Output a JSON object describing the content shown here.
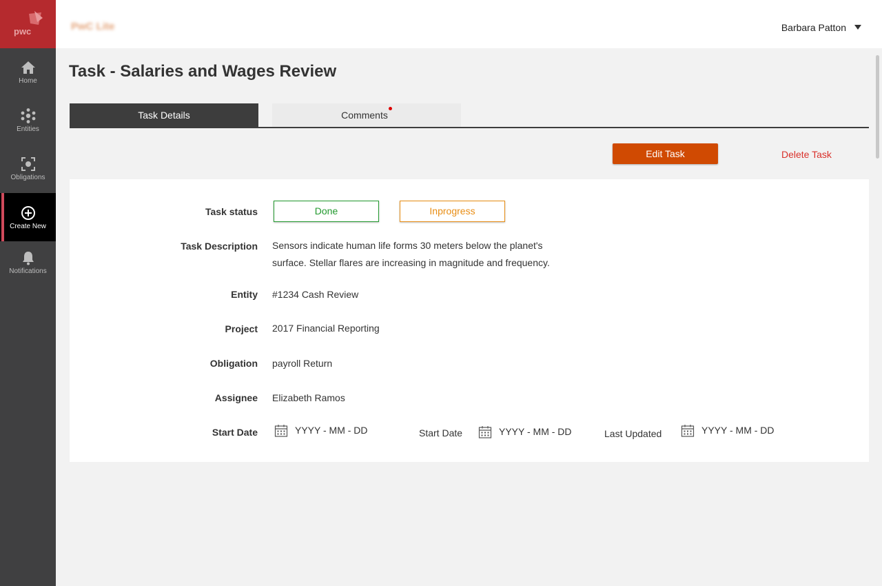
{
  "brand": {
    "name": "PwC Lite"
  },
  "user": {
    "name": "Barbara Patton"
  },
  "nav": {
    "home": "Home",
    "entities": "Entities",
    "obligations": "Obligations",
    "create_new": "Create New",
    "notifications": "Notifications"
  },
  "page": {
    "title": "Task - Salaries and Wages Review"
  },
  "tabs": {
    "details": "Task Details",
    "comments": "Comments"
  },
  "actions": {
    "edit": "Edit Task",
    "delete": "Delete Task"
  },
  "task": {
    "status_label": "Task status",
    "status_done": "Done",
    "status_inprogress": "Inprogress",
    "description_label": "Task Description",
    "description": "Sensors indicate human life forms 30 meters below the planet's surface. Stellar flares are increasing in magnitude and frequency.",
    "entity_label": "Entity",
    "entity": "#1234 Cash Review",
    "project_label": "Project",
    "project": "2017 Financial Reporting",
    "obligation_label": "Obligation",
    "obligation": "payroll Return",
    "assignee_label": "Assignee",
    "assignee": "Elizabeth Ramos",
    "start_date_label": "Start Date",
    "start_date_placeholder": "YYYY - MM - DD",
    "start_date2_label": "Start Date",
    "start_date2_placeholder": "YYYY - MM - DD",
    "last_updated_label": "Last Updated",
    "last_updated_placeholder": "YYYY - MM - DD"
  },
  "colors": {
    "brand_red": "#b52a2e",
    "accent_orange": "#d04a02",
    "done_green": "#22992e",
    "inprogress_orange": "#e88d14",
    "delete_red": "#d9312b"
  }
}
